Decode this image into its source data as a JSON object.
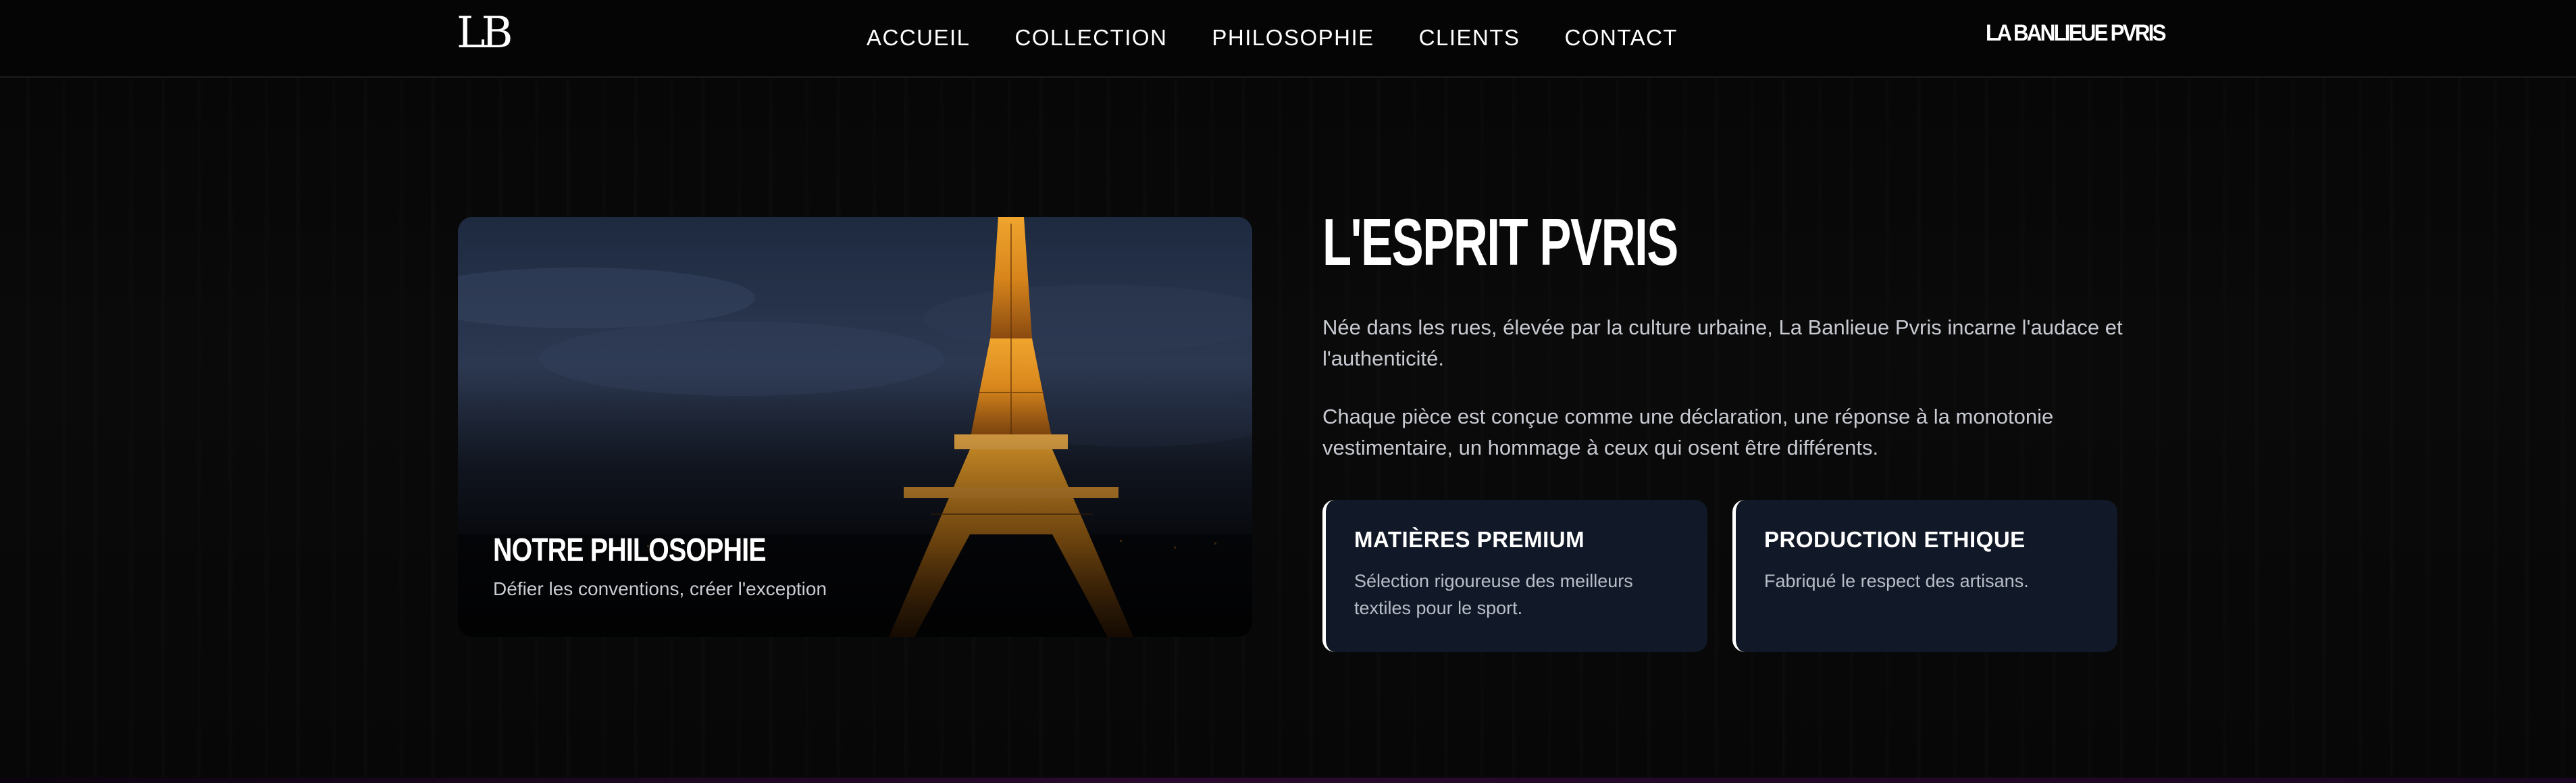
{
  "nav": {
    "logo_text": "LB",
    "links": [
      "ACCUEIL",
      "COLLECTION",
      "PHILOSOPHIE",
      "CLIENTS",
      "CONTACT"
    ],
    "brand": "LA BANLIEUE PVRIS"
  },
  "image_card": {
    "title": "NOTRE PHILOSOPHIE",
    "subtitle": "Défier les conventions, créer l'exception",
    "image_subject": "eiffel-tower-night"
  },
  "section": {
    "title": "L'ESPRIT PVRIS",
    "paragraphs": [
      "Née dans les rues, élevée par la culture urbaine, La Banlieue Pvris incarne l'audace et l'authenticité.",
      "Chaque pièce est conçue comme une déclaration, une réponse à la monotonie vestimentaire, un hommage à ceux qui osent être différents."
    ]
  },
  "features": [
    {
      "title": "MATIÈRES PREMIUM",
      "description": "Sélection rigoureuse des meilleurs textiles pour le sport."
    },
    {
      "title": "PRODUCTION ETHIQUE",
      "description": "Fabriqué le respect des artisans."
    }
  ],
  "colors": {
    "background": "#050505",
    "card_bg": "#111827",
    "text": "#ffffff",
    "muted_text": "#c7cad1",
    "accent_gold": "#e8a033"
  }
}
